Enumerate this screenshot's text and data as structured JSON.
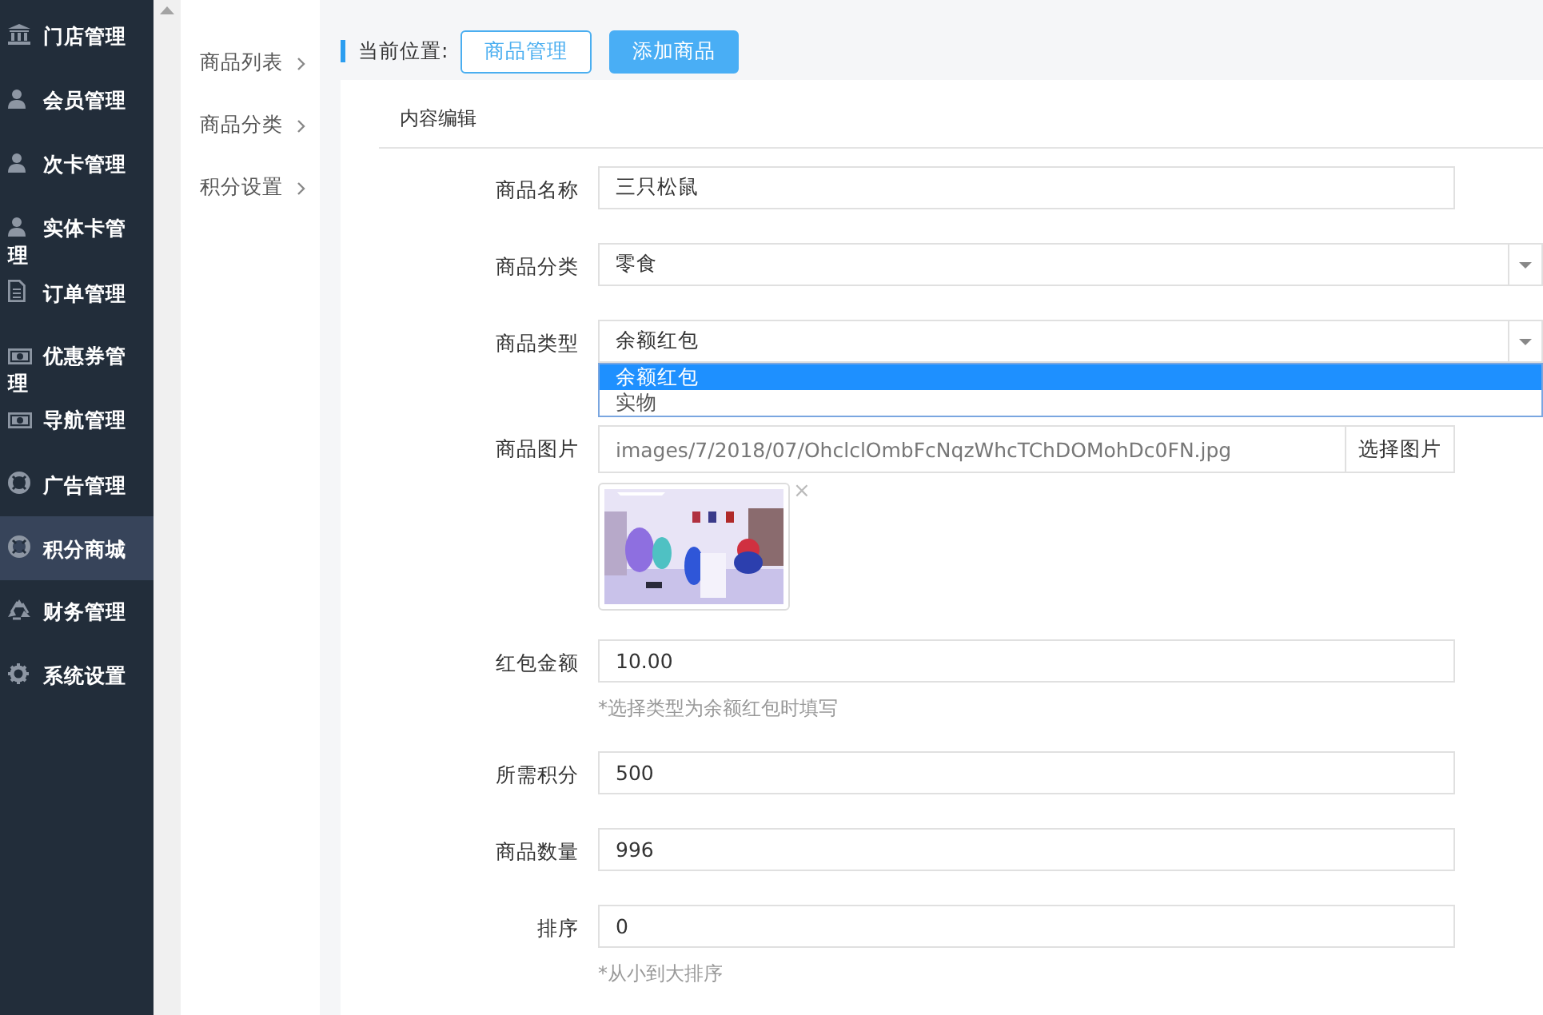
{
  "sidebar": {
    "items": [
      {
        "label": "门店管理",
        "kind": "bank",
        "selected": false
      },
      {
        "label": "会员管理",
        "kind": "user",
        "selected": false
      },
      {
        "label": "次卡管理",
        "kind": "user",
        "selected": false
      },
      {
        "label": "实体卡管理",
        "kind": "user",
        "selected": false
      },
      {
        "label": "订单管理",
        "kind": "file",
        "selected": false
      },
      {
        "label": "优惠券管理",
        "kind": "money",
        "selected": false
      },
      {
        "label": "导航管理",
        "kind": "money",
        "selected": false
      },
      {
        "label": "广告管理",
        "kind": "lifebuoy",
        "selected": false
      },
      {
        "label": "积分商城",
        "kind": "lifebuoy",
        "selected": true
      },
      {
        "label": "财务管理",
        "kind": "recycle",
        "selected": false
      },
      {
        "label": "系统设置",
        "kind": "gear",
        "selected": false
      }
    ]
  },
  "submenu": {
    "items": [
      {
        "label": "商品列表"
      },
      {
        "label": "商品分类"
      },
      {
        "label": "积分设置"
      }
    ]
  },
  "breadcrumb": {
    "label": "当前位置:",
    "buttons": [
      {
        "label": "商品管理",
        "kind": "outline"
      },
      {
        "label": "添加商品",
        "kind": "primary"
      }
    ]
  },
  "panel": {
    "title": "内容编辑",
    "fields": [
      {
        "kind": "text",
        "label": "商品名称",
        "value": "三只松鼠"
      },
      {
        "kind": "select",
        "label": "商品分类",
        "value": "零食"
      },
      {
        "kind": "select",
        "label": "商品类型",
        "value": "余额红包",
        "options": [
          {
            "label": "余额红包",
            "selected": true
          },
          {
            "label": "实物",
            "selected": false
          }
        ]
      },
      {
        "label": "商品图片",
        "value": "images/7/2018/07/OhclclOmbFcNqzWhcTChDOMohDc0FN.jpg",
        "button": "选择图片",
        "remove": "×"
      },
      {
        "kind": "text",
        "label": "红包金额",
        "value": "10.00",
        "hint": "*选择类型为余额红包时填写"
      },
      {
        "kind": "text",
        "label": "所需积分",
        "value": "500"
      },
      {
        "kind": "text",
        "label": "商品数量",
        "value": "996"
      },
      {
        "kind": "text",
        "label": "排序",
        "value": "0",
        "hint": "*从小到大排序"
      }
    ]
  }
}
